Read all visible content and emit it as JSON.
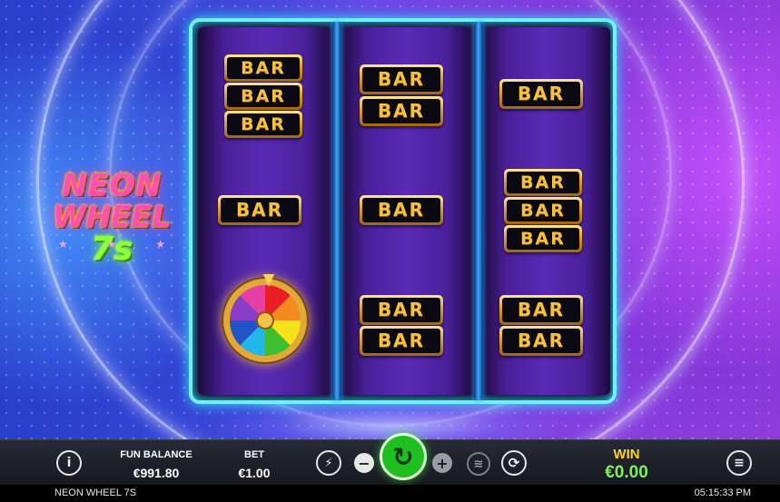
{
  "game": {
    "logo": {
      "line1": "NEON",
      "line2": "WHEEL",
      "line3": "7s"
    }
  },
  "reels": [
    {
      "symbols": [
        "BAR",
        "BAR",
        "BAR",
        "BAR",
        "wheel"
      ]
    },
    {
      "symbols": [
        "BAR",
        "BAR",
        "BAR",
        "BAR",
        "BAR"
      ]
    },
    {
      "symbols": [
        "BAR",
        "BAR",
        "BAR",
        "BAR",
        "BAR",
        "BAR"
      ]
    }
  ],
  "symbol_text": "BAR",
  "controls": {
    "info_icon": "i",
    "fun_balance_label": "FUN BALANCE",
    "fun_balance_value": "€991.80",
    "bet_label": "BET",
    "bet_value": "€1.00",
    "turbo_icon": "⚡",
    "minus": "−",
    "spin_icon": "↻",
    "plus": "+",
    "coins_icon": "≋",
    "autoplay_icon": "⟳",
    "win_label": "WIN",
    "win_value": "€0.00",
    "menu_icon": "≡"
  },
  "footer": {
    "game_name": "NEON WHEEL 7S",
    "clock": "05:15:33 PM"
  },
  "colors": {
    "cabinet_border": "#6ff0ff",
    "spin_button": "#1fbf1f",
    "win_label": "#ffd21a",
    "win_value": "#7ff05a"
  }
}
